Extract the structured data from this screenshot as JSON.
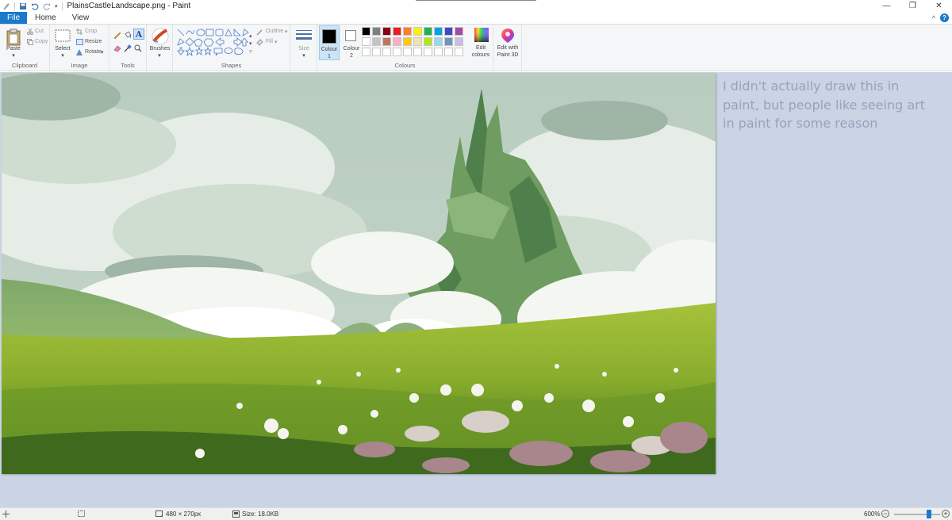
{
  "window": {
    "title": "PlainsCastleLandscape.png - Paint",
    "minimize": "—",
    "maximize": "❐",
    "close": "✕"
  },
  "tabs": [
    {
      "label": "File"
    },
    {
      "label": "Home"
    },
    {
      "label": "View"
    }
  ],
  "ribbon": {
    "clipboard": {
      "paste": "Paste",
      "cut": "Cut",
      "copy": "Copy",
      "group": "Clipboard"
    },
    "image": {
      "select": "Select",
      "crop": "Crop",
      "resize": "Resize",
      "rotate": "Rotate",
      "group": "Image"
    },
    "tools": {
      "group": "Tools"
    },
    "brushes": {
      "label": "Brushes"
    },
    "shapes": {
      "outline": "Outline",
      "fill": "Fill",
      "group": "Shapes"
    },
    "size": {
      "label": "Size"
    },
    "colours": {
      "colour1": "Colour",
      "colour1_num": "1",
      "colour2": "Colour",
      "colour2_num": "2",
      "edit": "Edit",
      "edit2": "colours",
      "paint3d": "Edit with",
      "paint3d2": "Paint 3D",
      "group": "Colours",
      "palette_row1": [
        "#000000",
        "#7f7f7f",
        "#880015",
        "#ed1c24",
        "#ff7f27",
        "#fff200",
        "#22b14c",
        "#00a2e8",
        "#3f48cc",
        "#a349a4"
      ],
      "palette_row2": [
        "#ffffff",
        "#c3c3c3",
        "#b97a57",
        "#ffaec9",
        "#ffc90e",
        "#efe4b0",
        "#b5e61d",
        "#99d9ea",
        "#7092be",
        "#c8bfe7"
      ]
    }
  },
  "overlay_text": "I didn't actually draw this in paint, but people like seeing art in paint for some reason",
  "status": {
    "dimensions": "480 × 270px",
    "size": "Size: 18.0KB",
    "zoom": "600%"
  }
}
